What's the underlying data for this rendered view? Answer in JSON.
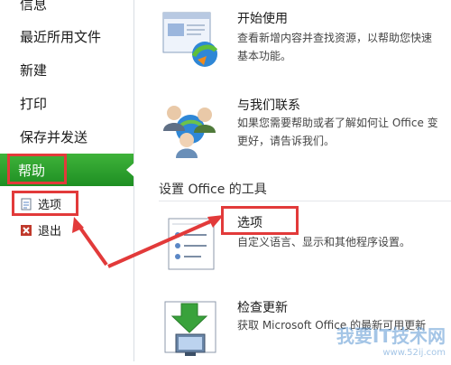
{
  "sidebar": {
    "items": [
      {
        "label": "信息"
      },
      {
        "label": "最近所用文件"
      },
      {
        "label": "新建"
      },
      {
        "label": "打印"
      },
      {
        "label": "保存并发送"
      }
    ],
    "help_label": "帮助",
    "sub_items": [
      {
        "label": "选项",
        "icon": "options-doc-icon"
      },
      {
        "label": "退出",
        "icon": "exit-x-icon"
      }
    ]
  },
  "main": {
    "items": [
      {
        "title": "开始使用",
        "desc": "查看新增内容并查找资源，以帮助您快速\n基本功能。",
        "icon": "getting-started-icon"
      },
      {
        "title": "与我们联系",
        "desc": "如果您需要帮助或者了解如何让 Office 变\n更好，请告诉我们。",
        "icon": "contact-us-icon"
      }
    ],
    "section_title": "设置 Office 的工具",
    "tools": [
      {
        "title": "选项",
        "desc": "自定义语言、显示和其他程序设置。",
        "icon": "options-list-icon"
      },
      {
        "title": "检查更新",
        "desc": "获取 Microsoft Office 的最新可用更新",
        "icon": "update-download-icon"
      }
    ]
  },
  "watermark": {
    "text": "我要IT技术网",
    "url": "www.52ij.com"
  },
  "colors": {
    "help_green": "#2aa02e",
    "annotation_red": "#e23a3a"
  }
}
